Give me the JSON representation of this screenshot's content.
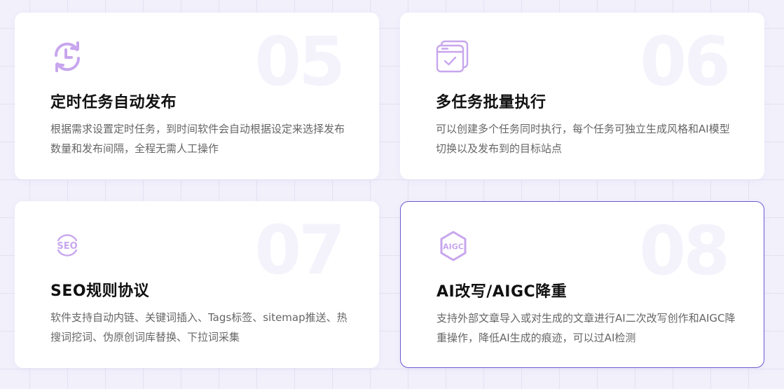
{
  "features": [
    {
      "number": "05",
      "icon": "clock-refresh-icon",
      "title": "定时任务自动发布",
      "desc": "根据需求设置定时任务，到时间软件会自动根据设定来选择发布数量和发布间隔，全程无需人工操作"
    },
    {
      "number": "06",
      "icon": "batch-check-icon",
      "title": "多任务批量执行",
      "desc": "可以创建多个任务同时执行，每个任务可独立生成风格和AI模型切换以及发布到的目标站点"
    },
    {
      "number": "07",
      "icon": "seo-icon",
      "icon_text": "SEO",
      "title": "SEO规则协议",
      "desc": "软件支持自动内链、关键词插入、Tags标签、sitemap推送、热搜词挖词、伪原创词库替换、下拉词采集"
    },
    {
      "number": "08",
      "icon": "aigc-icon",
      "icon_text": "AIGC",
      "title": "AI改写/AIGC降重",
      "desc": "支持外部文章导入或对生成的文章进行AI二次改写创作和AIGC降重操作，降低AI生成的痕迹，可以过AI检测"
    }
  ],
  "colors": {
    "accent": "#6a5bd0",
    "icon": "#c8a6ee",
    "number": "#f4f3fc",
    "title": "#111111",
    "desc": "#666666",
    "background": "#f1f0fb"
  }
}
